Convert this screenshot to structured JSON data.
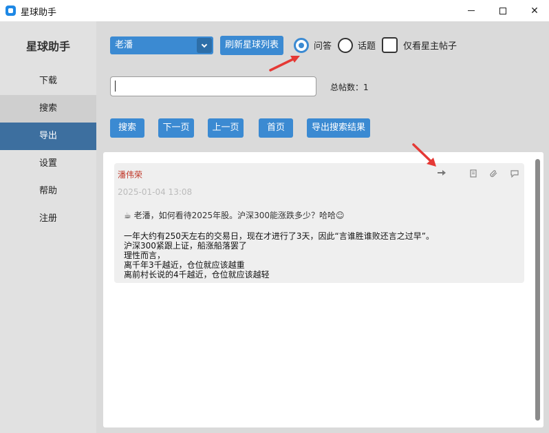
{
  "window": {
    "title": "星球助手",
    "min_label": "",
    "max_label": "",
    "close_label": "✕"
  },
  "sidebar": {
    "title": "星球助手",
    "items": [
      {
        "label": "下载"
      },
      {
        "label": "搜索"
      },
      {
        "label": "导出"
      },
      {
        "label": "设置"
      },
      {
        "label": "帮助"
      },
      {
        "label": "注册"
      }
    ]
  },
  "toolbar": {
    "planet_select": "老潘",
    "refresh_label": "刷新星球列表",
    "radio_qa": "问答",
    "radio_topic": "话题",
    "owner_only": "仅看星主帖子",
    "search_value": "",
    "total_label": "总帖数：1"
  },
  "actions": {
    "search": "搜索",
    "next_page": "下一页",
    "prev_page": "上一页",
    "first_page": "首页",
    "export_results": "导出搜索结果"
  },
  "post": {
    "author": "潘伟荣",
    "time": "2025-01-04 13:08",
    "question": "☕ 老潘，如何看待2025年股。沪深300能涨跌多少？哈哈☺",
    "body": [
      "一年大约有250天左右的交易日，现在才进行了3天，因此“言谁胜谁败还言之过早”。",
      "沪深300紧跟上证，船涨船落罢了",
      "理性而言，",
      "离千年3千越近，仓位就应该越重",
      "离前村长说的4千越近，仓位就应该越轻"
    ]
  },
  "colors": {
    "accent": "#3b8ad2",
    "sidebar_active": "#3d6f9f",
    "author": "#c0392b",
    "annotation": "#e53935"
  },
  "icons": [
    "forward-icon",
    "document-icon",
    "attachment-icon",
    "comment-icon"
  ]
}
